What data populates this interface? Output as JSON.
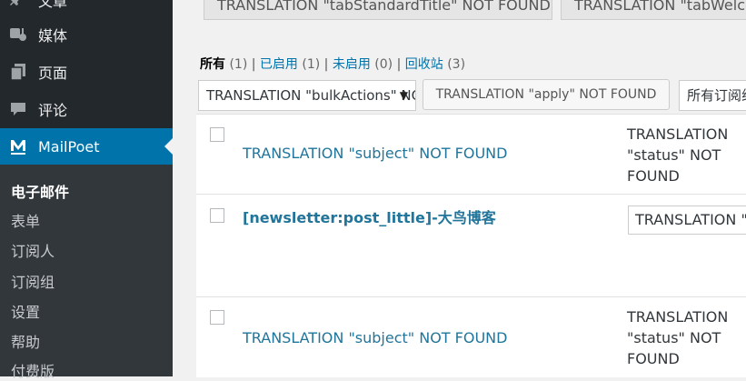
{
  "sidebar": {
    "items": [
      {
        "label": "文章",
        "icon": "pin-icon"
      },
      {
        "label": "媒体",
        "icon": "media-icon"
      },
      {
        "label": "页面",
        "icon": "pages-icon"
      },
      {
        "label": "评论",
        "icon": "comments-icon"
      },
      {
        "label": "MailPoet",
        "icon": "mailpoet-icon"
      }
    ],
    "submenu": [
      "电子邮件",
      "表单",
      "订阅人",
      "订阅组",
      "设置",
      "帮助",
      "付费版"
    ]
  },
  "tabs": [
    "TRANSLATION \"tabStandardTitle\" NOT FOUND",
    "TRANSLATION \"tabWelcomeTitle\" NOT FOUND"
  ],
  "filters": {
    "all_label": "所有",
    "all_count": "(1)",
    "active_label": "已启用",
    "active_count": "(1)",
    "inactive_label": "未启用",
    "inactive_count": "(0)",
    "trash_label": "回收站",
    "trash_count": "(3)"
  },
  "controls": {
    "bulk_actions": "TRANSLATION \"bulkActions\" NOT FOUND",
    "apply": "TRANSLATION \"apply\" NOT FOUND",
    "segments_filter": "所有订阅组"
  },
  "rows": [
    {
      "subject": "TRANSLATION \"subject\" NOT FOUND",
      "status": "TRANSLATION \"status\" NOT FOUND"
    },
    {
      "subject": "[newsletter:post_little]-大鸟博客",
      "select_value": "TRANSLATION \"active\" NOT FOUND"
    },
    {
      "subject": "TRANSLATION \"subject\" NOT FOUND",
      "status": "TRANSLATION \"status\" NOT FOUND"
    }
  ]
}
